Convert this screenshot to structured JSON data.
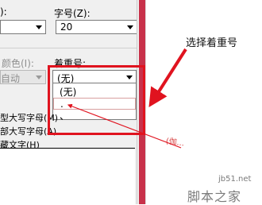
{
  "dialog": {
    "font_size_label": "字号(Z):",
    "font_size_value": "20",
    "font_color_label": "颜色(I):",
    "font_color_value": "自动",
    "emphasis_label": "着重号:",
    "emphasis_value": "(无)",
    "emphasis_options": [
      "(无)",
      ".",
      "、"
    ],
    "effects": [
      "型大写字母(M)",
      "部大写字母(A)",
      "藏文字(H)"
    ]
  },
  "annotation": {
    "callout_text": "选择着重号"
  },
  "document": {
    "partial_text": "(伽..."
  },
  "watermark": {
    "site": "jb51.net",
    "name": "脚本之家"
  },
  "colors": {
    "highlight": "#e0131f",
    "strip": "#c8314a"
  }
}
